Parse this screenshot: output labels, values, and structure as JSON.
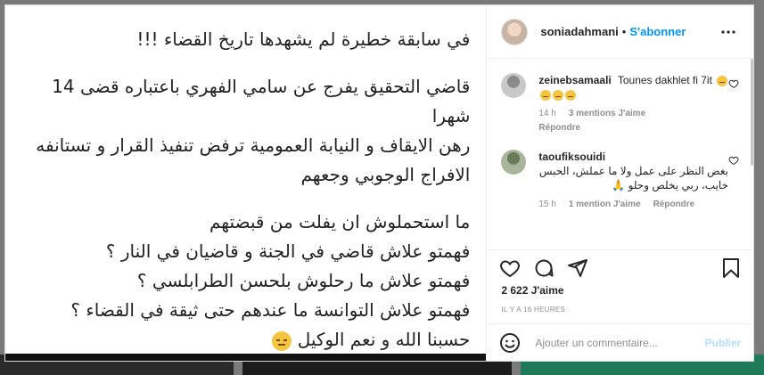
{
  "colors": {
    "accent": "#0095f6",
    "text": "#262626",
    "muted": "#8e8e8e",
    "publish_disabled": "#b2dffc"
  },
  "post": {
    "lines": [
      "في سابقة خطيرة لم يشهدها تاريخ القضاء !!!",
      "قاضي التحقيق يفرج عن سامي الفهري باعتباره قضى 14 شهرا",
      "رهن الايقاف و النيابة العمومية ترفض تنفيذ القرار و تستانفه",
      "الافراج الوجوبي وجعهم",
      "ما استحملوش ان يفلت من قبضتهم",
      "فهمتو علاش قاضي في الجنة و قاضيان في النار ؟",
      "فهمتو علاش ما رحلوش بلحسن الطرابلسي ؟",
      "فهمتو علاش التوانسة ما عندهم حتى ثيقة في القضاء ؟",
      "حسبنا الله و نعم الوكيل"
    ]
  },
  "header": {
    "username": "soniadahmani",
    "separator": "•",
    "follow_label": "S'abonner",
    "more_icon": "more-horizontal-icon"
  },
  "comments": [
    {
      "user": "zeinebsamaali",
      "text": "Tounes dakhlet fi 7it",
      "emoji_count": 4,
      "time": "14 h",
      "likes": "3 mentions J'aime",
      "reply": "Répondre"
    },
    {
      "user": "taoufiksouidi",
      "text": "بغض النظر على عمل ولا ما عملش، الحبس خايب، ربي يخلص وحلو 🙏",
      "time": "15 h",
      "likes": "1 mention J'aime",
      "reply": "Répondre"
    }
  ],
  "actions": {
    "like_icon": "heart-icon",
    "comment_icon": "comment-icon",
    "share_icon": "share-icon",
    "save_icon": "bookmark-icon"
  },
  "likes_label": "2 622 J'aime",
  "timestamp": "IL Y A 16 HEURES",
  "comment_box": {
    "placeholder": "Ajouter un commentaire...",
    "publish_label": "Publier"
  }
}
